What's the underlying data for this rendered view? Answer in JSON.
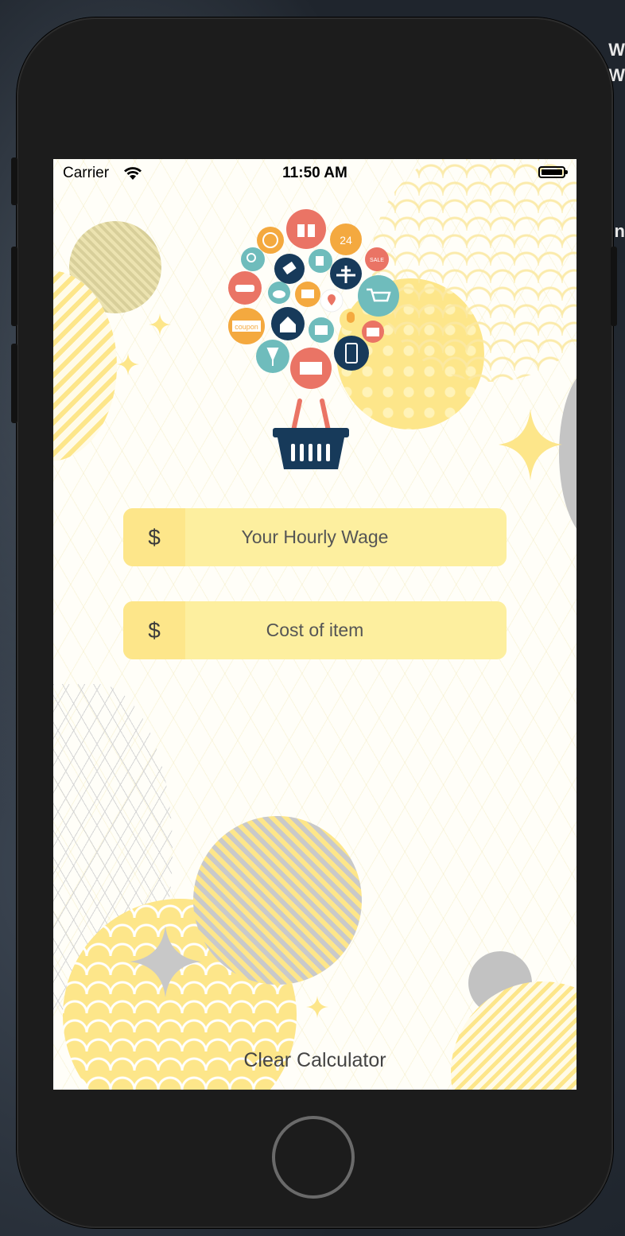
{
  "status_bar": {
    "carrier": "Carrier",
    "time": "11:50 AM"
  },
  "form": {
    "currency_symbol": "$",
    "wage_placeholder": "Your Hourly Wage",
    "cost_placeholder": "Cost of item"
  },
  "actions": {
    "clear_label": "Clear Calculator"
  },
  "desktop": {
    "edge_text_1": "W",
    "edge_text_2": "W",
    "edge_text_3": "n"
  },
  "colors": {
    "accent_yellow": "#fde68a",
    "field_bg": "#fdef9f",
    "basket_navy": "#173a5a",
    "coral": "#ea7465",
    "teal": "#6fbcbc",
    "orange": "#f4a93f"
  },
  "icons": [
    "gift-icon",
    "globe-icon",
    "clock-24-icon",
    "search-icon",
    "tag-icon",
    "airplane-icon",
    "sale-icon",
    "car-icon",
    "cloud-icon",
    "tv-icon",
    "location-pin-icon",
    "shopping-cart-icon",
    "coupon-icon",
    "house-icon",
    "photo-icon",
    "popsicle-icon",
    "briefcase-icon",
    "wine-icon",
    "store-icon",
    "smartphone-icon",
    "basket-icon"
  ]
}
